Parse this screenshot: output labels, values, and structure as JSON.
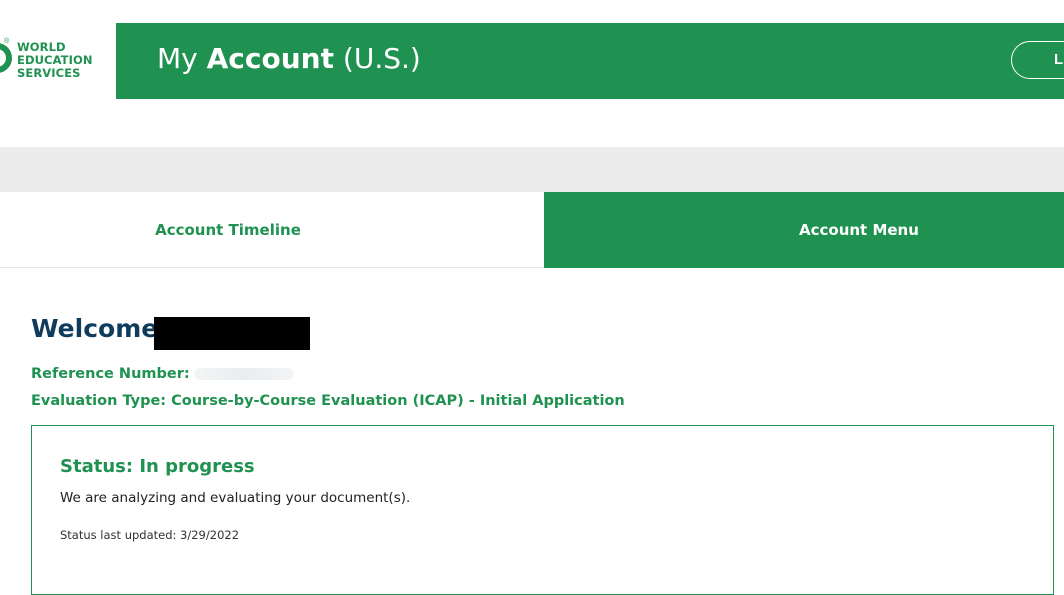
{
  "brand": {
    "logo_lines": [
      "WORLD",
      "EDUCATION",
      "SERVICES"
    ],
    "logo_reg_mark": "®",
    "color": "#1f9150"
  },
  "header": {
    "title_prefix": "My",
    "title_bold": "Account",
    "title_suffix": "(U.S.)",
    "pill_label": "L"
  },
  "tabs": [
    {
      "label": "Account Timeline",
      "active": false
    },
    {
      "label": "Account Menu",
      "active": true
    }
  ],
  "welcome": {
    "greeting": "Welcome",
    "reference_label": "Reference Number:",
    "evaluation_type": "Evaluation Type: Course-by-Course Evaluation (ICAP) - Initial Application"
  },
  "status": {
    "title": "Status: In progress",
    "description": "We are analyzing and evaluating your document(s).",
    "last_updated": "Status last updated: 3/29/2022"
  },
  "colors": {
    "primary_green": "#1f9150",
    "navy": "#0f3b5c",
    "band_gray": "#ececec"
  }
}
